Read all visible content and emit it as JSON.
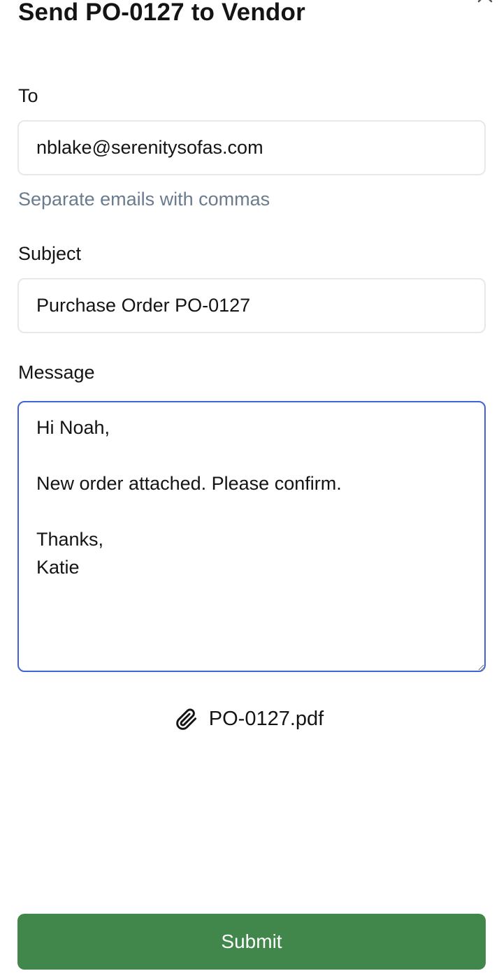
{
  "dialog": {
    "title": "Send PO-0127 to Vendor",
    "close_icon": "close-icon"
  },
  "form": {
    "to": {
      "label": "To",
      "value": "nblake@serenitysofas.com",
      "hint": "Separate emails with commas"
    },
    "subject": {
      "label": "Subject",
      "value": "Purchase Order PO-0127"
    },
    "message": {
      "label": "Message",
      "value": "Hi Noah,\n\nNew order attached. Please confirm.\n\nThanks,\nKatie"
    }
  },
  "attachment": {
    "icon": "paperclip-icon",
    "filename": "PO-0127.pdf"
  },
  "actions": {
    "submit_label": "Submit"
  },
  "colors": {
    "focus_border": "#3d63d6",
    "submit_bg": "#41864a",
    "hint_text": "#6b7b8e",
    "field_border": "#e6e8eb"
  }
}
